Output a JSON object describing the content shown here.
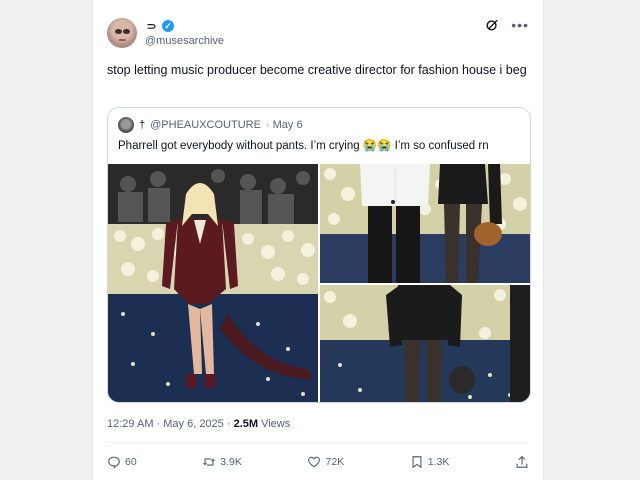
{
  "post": {
    "display_name_glyph": "⸧",
    "handle": "@musesarchive",
    "text": "stop letting music producer become creative director for fashion house i beg",
    "timestamp": "12:29 AM · May 6, 2025 · ",
    "views_count": "2.5M",
    "views_label": " Views"
  },
  "quote": {
    "name": "†",
    "handle": "@PHEAUXCOUTURE",
    "date": "· May 6",
    "text": "Pharrell got everybody without pants. I’m crying 😭😭 I’m so confused rn"
  },
  "actions": {
    "replies": "60",
    "reposts": "3.9K",
    "likes": "72K",
    "bookmarks": "1.3K"
  },
  "icons": [
    "grok-icon",
    "more-icon",
    "verified-icon",
    "reply-icon",
    "repost-icon",
    "like-icon",
    "bookmark-icon",
    "share-icon"
  ],
  "colors": {
    "accent": "#1d9bf0",
    "muted_text": "#536471",
    "text": "#0f1419",
    "border": "#cfd9de"
  }
}
